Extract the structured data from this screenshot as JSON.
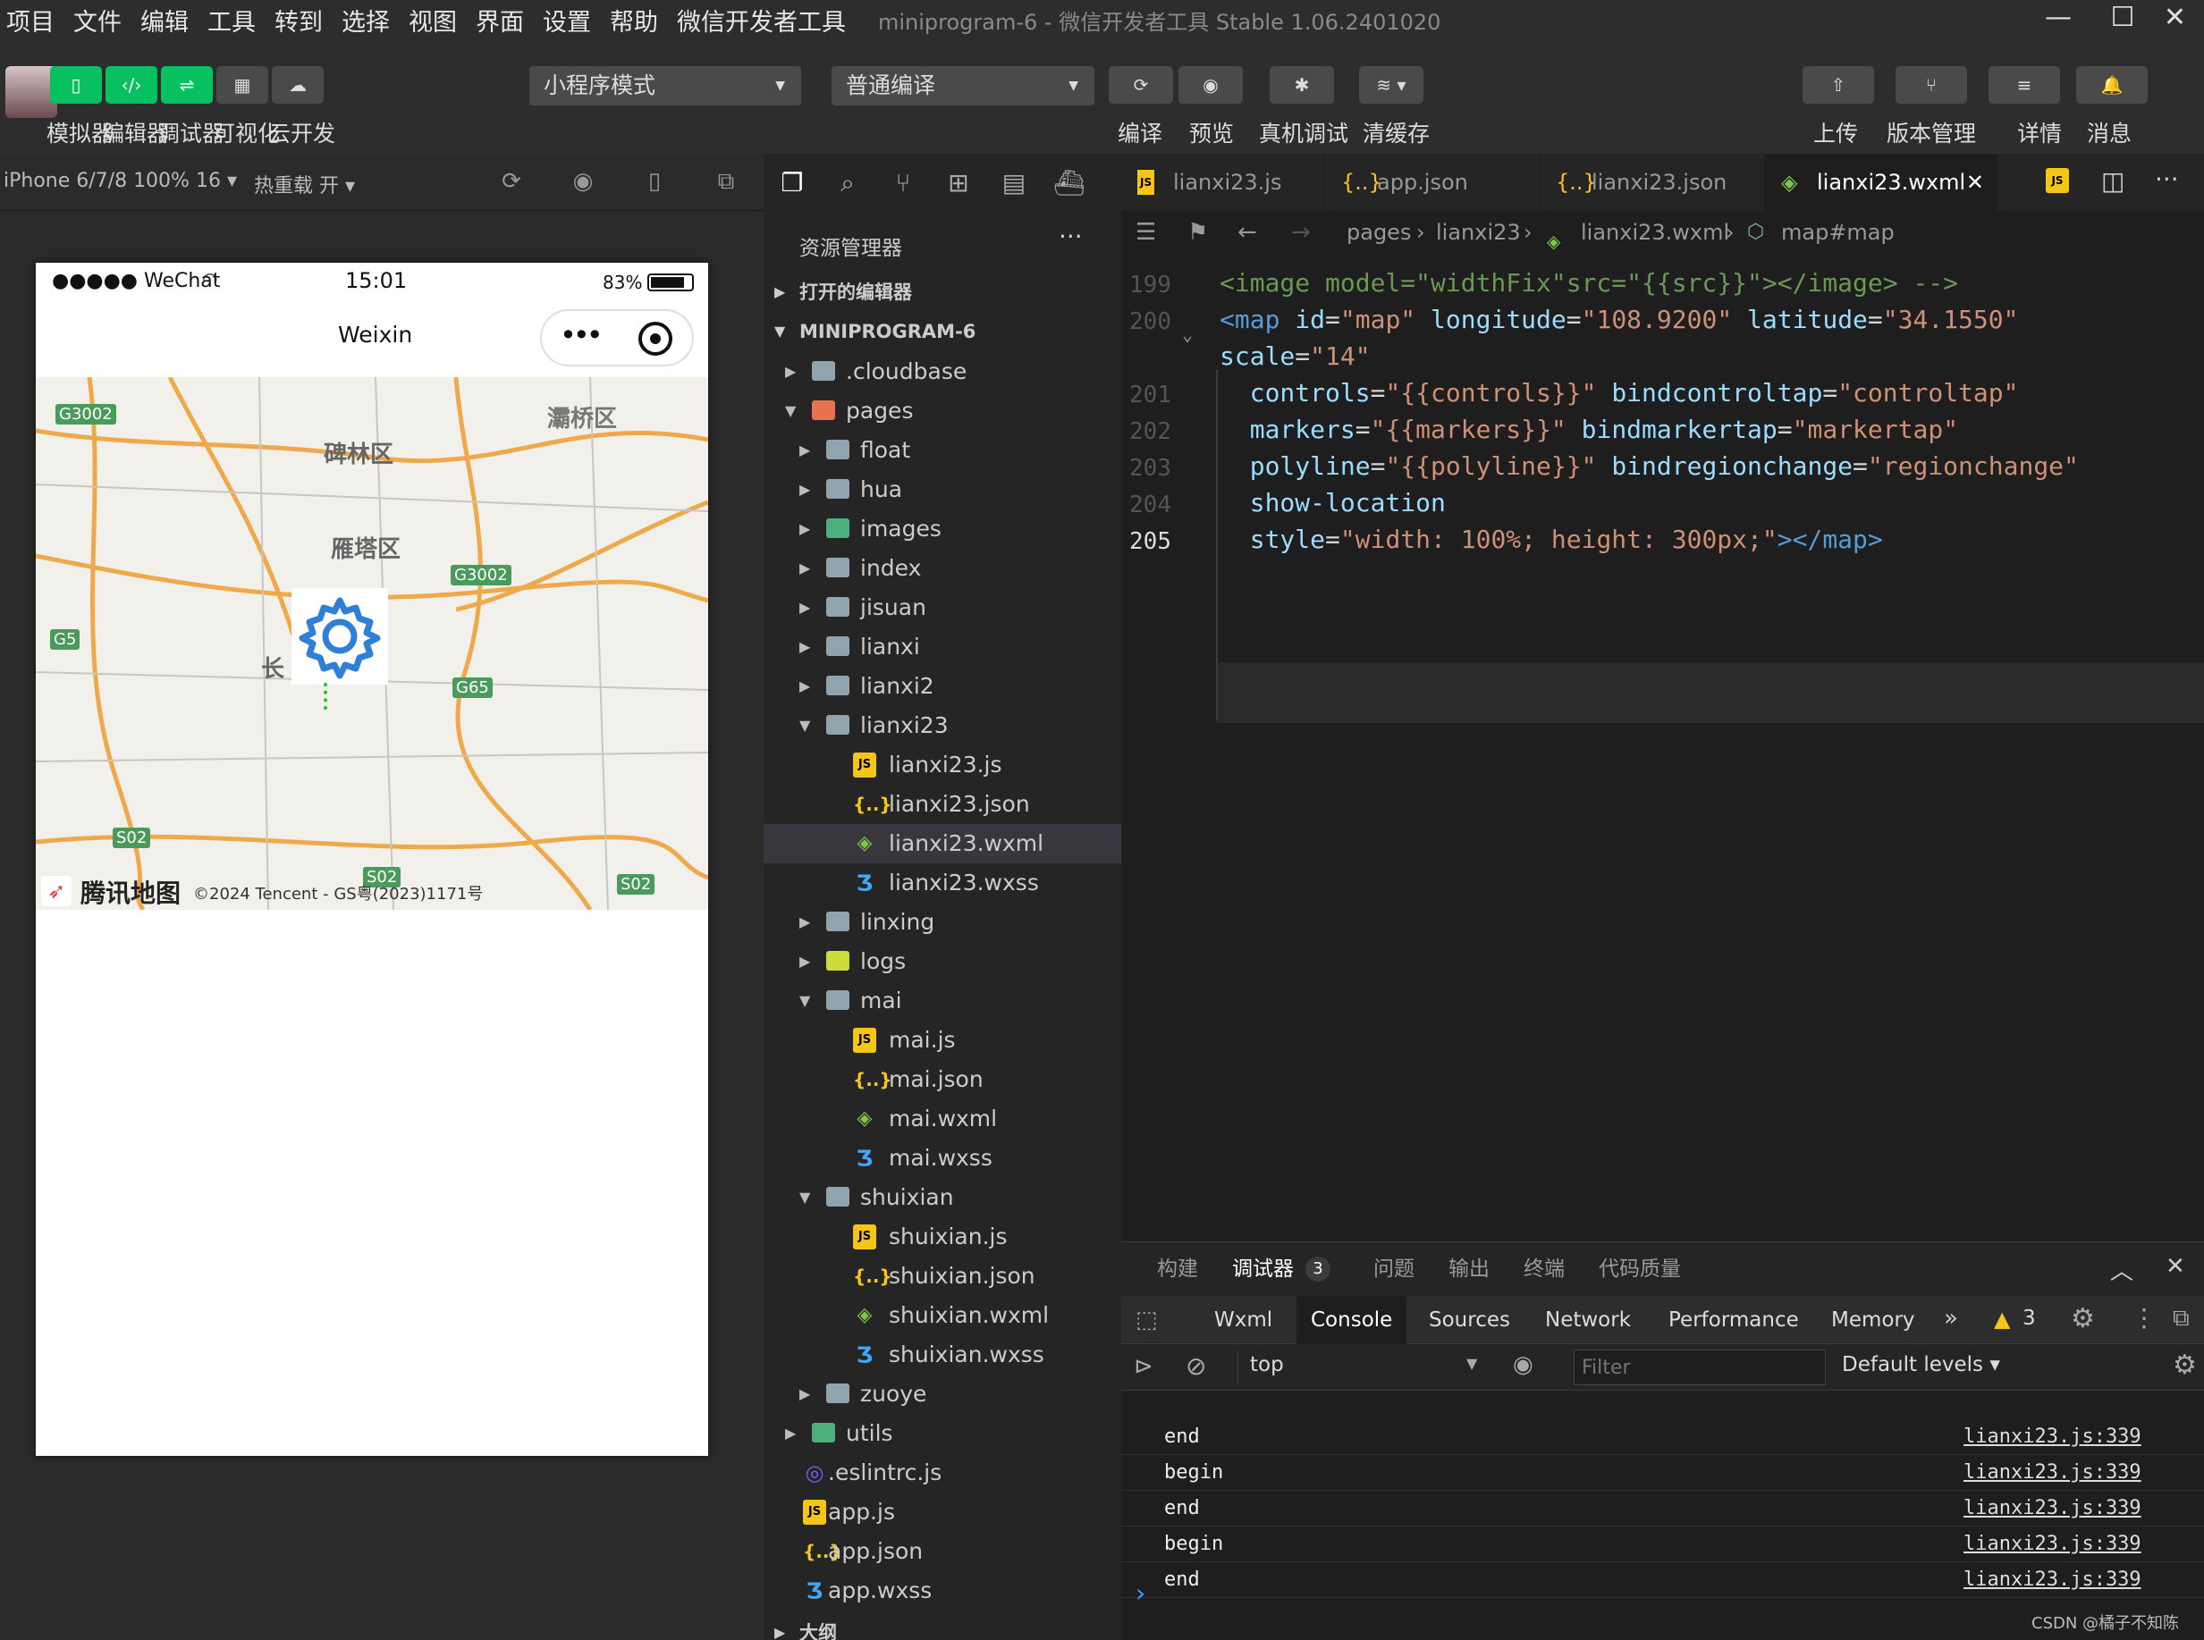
{
  "menu": [
    "项目",
    "文件",
    "编辑",
    "工具",
    "转到",
    "选择",
    "视图",
    "界面",
    "设置",
    "帮助",
    "微信开发者工具"
  ],
  "window_title": "miniprogram-6 - 微信开发者工具 Stable 1.06.2401020",
  "toolbar": {
    "buttons": [
      {
        "label": "模拟器",
        "icon": "phone-icon"
      },
      {
        "label": "编辑器",
        "icon": "code-icon"
      },
      {
        "label": "调试器",
        "icon": "debug-sliders-icon"
      },
      {
        "label": "可视化",
        "icon": "layout-icon"
      },
      {
        "label": "云开发",
        "icon": "cloud-icon"
      }
    ],
    "mode_select": "小程序模式",
    "compile_select": "普通编译",
    "actions": [
      {
        "label": "编译",
        "icon": "refresh-icon"
      },
      {
        "label": "预览",
        "icon": "eye-icon"
      },
      {
        "label": "真机调试",
        "icon": "bug-icon"
      },
      {
        "label": "清缓存",
        "icon": "layers-icon"
      }
    ],
    "right_actions": [
      {
        "label": "上传",
        "icon": "upload-icon"
      },
      {
        "label": "版本管理",
        "icon": "branch-icon"
      },
      {
        "label": "详情",
        "icon": "menu-icon"
      },
      {
        "label": "消息",
        "icon": "bell-icon"
      }
    ]
  },
  "simulator": {
    "device": "iPhone 6/7/8 100% 16",
    "hot_reload": "热重载 开",
    "status": {
      "carrier": "●●●●● WeChat",
      "time": "15:01",
      "battery": "83%"
    },
    "nav_title": "Weixin",
    "map": {
      "labels": [
        "碑林区",
        "雁塔区",
        "灞桥区",
        "长"
      ],
      "roads": [
        "G3002",
        "G3002",
        "G5",
        "G65",
        "S02",
        "S02",
        "S02"
      ],
      "logo": "腾讯地图",
      "copyright": "©2024 Tencent - GS粤(2023)1171号"
    }
  },
  "explorer": {
    "title": "资源管理器",
    "open_editors": "打开的编辑器",
    "project": "MINIPROGRAM-6",
    "tree": [
      {
        "name": ".cloudbase",
        "type": "folder",
        "depth": 1,
        "open": false
      },
      {
        "name": "pages",
        "type": "folder-red",
        "depth": 1,
        "open": true
      },
      {
        "name": "float",
        "type": "folder",
        "depth": 2,
        "open": false
      },
      {
        "name": "hua",
        "type": "folder",
        "depth": 2,
        "open": false
      },
      {
        "name": "images",
        "type": "folder-green",
        "depth": 2,
        "open": false
      },
      {
        "name": "index",
        "type": "folder",
        "depth": 2,
        "open": false
      },
      {
        "name": "jisuan",
        "type": "folder",
        "depth": 2,
        "open": false
      },
      {
        "name": "lianxi",
        "type": "folder",
        "depth": 2,
        "open": false
      },
      {
        "name": "lianxi2",
        "type": "folder",
        "depth": 2,
        "open": false
      },
      {
        "name": "lianxi23",
        "type": "folder",
        "depth": 2,
        "open": true
      },
      {
        "name": "lianxi23.js",
        "type": "js",
        "depth": 3
      },
      {
        "name": "lianxi23.json",
        "type": "json",
        "depth": 3
      },
      {
        "name": "lianxi23.wxml",
        "type": "wxml",
        "depth": 3,
        "selected": true
      },
      {
        "name": "lianxi23.wxss",
        "type": "wxss",
        "depth": 3
      },
      {
        "name": "linxing",
        "type": "folder",
        "depth": 2,
        "open": false
      },
      {
        "name": "logs",
        "type": "folder-yellow",
        "depth": 2,
        "open": false
      },
      {
        "name": "mai",
        "type": "folder",
        "depth": 2,
        "open": true
      },
      {
        "name": "mai.js",
        "type": "js",
        "depth": 3
      },
      {
        "name": "mai.json",
        "type": "json",
        "depth": 3
      },
      {
        "name": "mai.wxml",
        "type": "wxml",
        "depth": 3
      },
      {
        "name": "mai.wxss",
        "type": "wxss",
        "depth": 3
      },
      {
        "name": "shuixian",
        "type": "folder",
        "depth": 2,
        "open": true
      },
      {
        "name": "shuixian.js",
        "type": "js",
        "depth": 3
      },
      {
        "name": "shuixian.json",
        "type": "json",
        "depth": 3
      },
      {
        "name": "shuixian.wxml",
        "type": "wxml",
        "depth": 3
      },
      {
        "name": "shuixian.wxss",
        "type": "wxss",
        "depth": 3
      },
      {
        "name": "zuoye",
        "type": "folder",
        "depth": 2,
        "open": false
      },
      {
        "name": "utils",
        "type": "folder-green",
        "depth": 1,
        "open": false
      },
      {
        "name": ".eslintrc.js",
        "type": "eslint",
        "depth": 1
      },
      {
        "name": "app.js",
        "type": "js",
        "depth": 1
      },
      {
        "name": "app.json",
        "type": "json",
        "depth": 1
      },
      {
        "name": "app.wxss",
        "type": "wxss",
        "depth": 1
      }
    ],
    "outline": "大纲"
  },
  "editor": {
    "tabs": [
      {
        "label": "lianxi23.js",
        "type": "js"
      },
      {
        "label": "app.json",
        "type": "json"
      },
      {
        "label": "lianxi23.json",
        "type": "json"
      },
      {
        "label": "lianxi23.wxml",
        "type": "wxml",
        "active": true
      }
    ],
    "breadcrumb": [
      "pages",
      "lianxi23",
      "lianxi23.wxml",
      "map#map"
    ],
    "lines": [
      {
        "n": "199",
        "html": "<span class=\"cmt\">&lt;image model=\"widthFix\"src=\"{{src}}\"&gt;&lt;/image&gt; --&gt;</span>"
      },
      {
        "n": "200",
        "html": "<span class=\"tag\">&lt;map</span> <span class=\"att\">id</span>=<span class=\"str\">\"map\"</span> <span class=\"att\">longitude</span>=<span class=\"str\">\"108.9200\"</span> <span class=\"att\">latitude</span>=<span class=\"str\">\"34.1550\"</span>"
      },
      {
        "n": "",
        "html": "<span class=\"att\">scale</span>=<span class=\"str\">\"14\"</span>"
      },
      {
        "n": "201",
        "html": "  <span class=\"att\">controls</span>=<span class=\"str\">\"{{controls}}\"</span> <span class=\"att\">bindcontroltap</span>=<span class=\"str\">\"controltap\"</span>"
      },
      {
        "n": "202",
        "html": "  <span class=\"att\">markers</span>=<span class=\"str\">\"{{markers}}\"</span> <span class=\"att\">bindmarkertap</span>=<span class=\"str\">\"markertap\"</span>"
      },
      {
        "n": "203",
        "html": "  <span class=\"att\">polyline</span>=<span class=\"str\">\"{{polyline}}\"</span> <span class=\"att\">bindregionchange</span>=<span class=\"str\">\"regionchange\"</span>"
      },
      {
        "n": "204",
        "html": "  <span class=\"att\">show-location</span>"
      },
      {
        "n": "205",
        "html": "  <span class=\"att\">style</span>=<span class=\"str\">\"width: 100%; height: 300px;\"</span><span class=\"tag\">&gt;&lt;/map&gt;</span>"
      }
    ]
  },
  "panel": {
    "tabs": [
      "构建",
      "调试器",
      "问题",
      "输出",
      "终端",
      "代码质量"
    ],
    "debugger_badge": "3",
    "devtools_tabs": [
      "Wxml",
      "Console",
      "Sources",
      "Network",
      "Performance",
      "Memory"
    ],
    "warnings": "3",
    "context": "top",
    "filter_placeholder": "Filter",
    "levels": "Default levels",
    "logs": [
      {
        "msg": "end",
        "src": "lianxi23.js:339"
      },
      {
        "msg": "begin",
        "src": "lianxi23.js:339"
      },
      {
        "msg": "end",
        "src": "lianxi23.js:339"
      },
      {
        "msg": "begin",
        "src": "lianxi23.js:339"
      },
      {
        "msg": "end",
        "src": "lianxi23.js:339"
      }
    ],
    "prompt": "›"
  },
  "watermark": "CSDN @橘子不知陈"
}
